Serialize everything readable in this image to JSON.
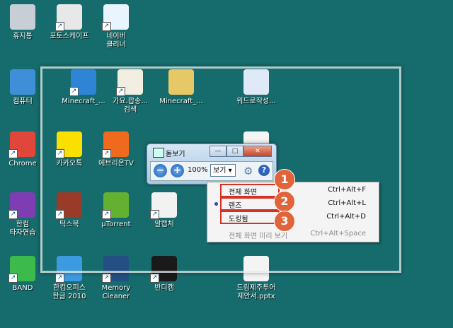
{
  "desktop_icons": [
    {
      "id": "recycle",
      "label": "휴지통",
      "icon": "recycle-bin-icon",
      "color": "#c7ced6",
      "shortcut": false
    },
    {
      "id": "fotoscape",
      "label": "포토스케이프",
      "icon": "photoscape-icon",
      "color": "#e8e8e8",
      "shortcut": true
    },
    {
      "id": "naver-cleaner",
      "label": "네이버\n클리너",
      "icon": "naver-cleaner-icon",
      "color": "#e9f4ff",
      "shortcut": true
    },
    {
      "id": "computer",
      "label": "컴퓨터",
      "icon": "computer-icon",
      "color": "#3f8fd8",
      "shortcut": false
    },
    {
      "id": "minecraft1",
      "label": "Minecraft_...",
      "icon": "zip-user-icon",
      "color": "#2f84d6",
      "shortcut": true
    },
    {
      "id": "music",
      "label": "가요.팝송...\n검색",
      "icon": "music-note-icon",
      "color": "#f2efe2",
      "shortcut": true
    },
    {
      "id": "minecraft2",
      "label": "Minecraft_...",
      "icon": "folder-icon",
      "color": "#e6c866",
      "shortcut": false
    },
    {
      "id": "hwp",
      "label": "워드로작성...",
      "icon": "hwp-doc-icon",
      "color": "#dfe9f7",
      "shortcut": false
    },
    {
      "id": "chrome",
      "label": "Chrome",
      "icon": "chrome-icon",
      "color": "#e0463a",
      "shortcut": true
    },
    {
      "id": "kakao",
      "label": "카카오톡",
      "icon": "kakaotalk-icon",
      "color": "#f9e000",
      "shortcut": true
    },
    {
      "id": "everyon",
      "label": "에브리온TV",
      "icon": "everyon-icon",
      "color": "#f06a1e",
      "shortcut": true
    },
    {
      "id": "doc",
      "label": "",
      "icon": "document-icon",
      "color": "#f5f5f5",
      "shortcut": false
    },
    {
      "id": "hancom",
      "label": "한컴\n타자연습",
      "icon": "hancom-typing-icon",
      "color": "#7e3db2",
      "shortcut": true
    },
    {
      "id": "taskbuk",
      "label": "턱스북",
      "icon": "crop-icon",
      "color": "#9a3a28",
      "shortcut": true
    },
    {
      "id": "utorrent",
      "label": "µTorrent",
      "icon": "utorrent-icon",
      "color": "#64b031",
      "shortcut": true
    },
    {
      "id": "alcapture",
      "label": "알캡처",
      "icon": "alcapture-icon",
      "color": "#f2f2f2",
      "shortcut": true
    },
    {
      "id": "band",
      "label": "BAND",
      "icon": "band-icon",
      "color": "#3cba4b",
      "shortcut": true
    },
    {
      "id": "hanoffice",
      "label": "한컴오피스\n한글 2010",
      "icon": "hancom-office-icon",
      "color": "#3c9be0",
      "shortcut": true
    },
    {
      "id": "memory",
      "label": "Memory\nCleaner",
      "icon": "memory-cleaner-icon",
      "color": "#244e84",
      "shortcut": true
    },
    {
      "id": "bandicam",
      "label": "반디캠",
      "icon": "bandicam-icon",
      "color": "#1a1a1a",
      "shortcut": true
    },
    {
      "id": "pptx",
      "label": "드림제주투어\n제안서.pptx",
      "icon": "pptx-icon",
      "color": "#f4f4f4",
      "shortcut": false
    }
  ],
  "magnifier": {
    "title": "돋보기",
    "zoom": "100%",
    "view_label": "보기 ▾",
    "minimize": "—",
    "maximize": "□",
    "close": "✕",
    "zoom_out": "−",
    "zoom_in": "+",
    "help": "?"
  },
  "menu": [
    {
      "label": "전체 화면",
      "shortcut": "Ctrl+Alt+F",
      "highlight": true,
      "checked": false,
      "disabled": false
    },
    {
      "label": "렌즈",
      "shortcut": "Ctrl+Alt+L",
      "highlight": true,
      "checked": true,
      "disabled": false
    },
    {
      "label": "도킹됨",
      "shortcut": "Ctrl+Alt+D",
      "highlight": true,
      "checked": false,
      "disabled": false
    },
    {
      "label": "전체 화면 미리 보기",
      "shortcut": "Ctrl+Alt+Space",
      "highlight": false,
      "checked": false,
      "disabled": true
    }
  ],
  "badges": [
    "1",
    "2",
    "3"
  ]
}
